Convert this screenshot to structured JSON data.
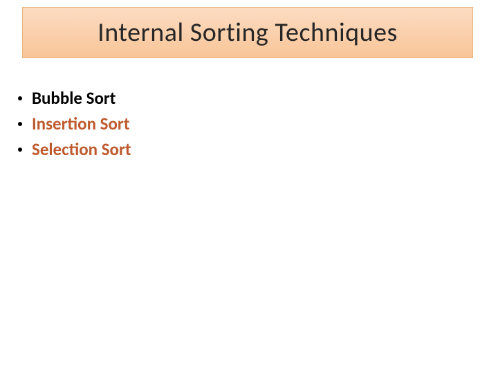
{
  "title": "Internal Sorting Techniques",
  "items": [
    {
      "label": "Bubble Sort",
      "color": "black"
    },
    {
      "label": "Insertion Sort",
      "color": "orange"
    },
    {
      "label": "Selection Sort",
      "color": "orange"
    }
  ]
}
